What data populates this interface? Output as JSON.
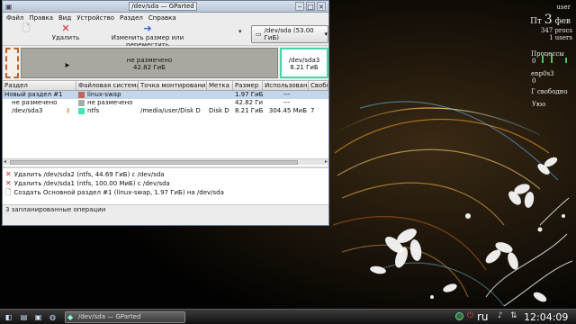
{
  "window": {
    "title": "/dev/sda — GParted"
  },
  "menu": {
    "items": [
      "Файл",
      "Правка",
      "Вид",
      "Устройство",
      "Раздел",
      "Справка"
    ]
  },
  "toolbar": {
    "delete_label": "Удалить",
    "resize_label": "Изменить размер или переместить",
    "device_label": "/dev/sda  (53.00 ГиБ)"
  },
  "diskmap": {
    "unallocated_label": "не размечено",
    "unallocated_size": "42.82 ГиБ",
    "sda3_label": "/dev/sda3",
    "sda3_size": "8.21 ГиБ"
  },
  "table": {
    "headers": [
      "Раздел",
      "Файловая система",
      "Точка монтирования",
      "Метка",
      "Размер",
      "Использовано",
      "Свобод"
    ],
    "rows": [
      {
        "partition": "Новый раздел #1",
        "fs": "linux-swap",
        "fs_color": "#c1665a",
        "mount": "",
        "label": "",
        "size": "1.97 ГиБ",
        "used": "---",
        "free": ""
      },
      {
        "partition": "не размечено",
        "fs": "не размечено",
        "fs_color": "#a9a9a9",
        "mount": "",
        "label": "",
        "size": "42.82 ГиБ",
        "used": "---",
        "free": ""
      },
      {
        "partition": "/dev/sda3",
        "fs": "ntfs",
        "fs_color": "#42e5ac",
        "mount": "/media/user/Disk D",
        "label": "Disk D",
        "size": "8.21 ГиБ",
        "used": "304.45 МиБ",
        "free": "7"
      }
    ]
  },
  "operations": {
    "items": [
      {
        "icon": "delete",
        "text": "Удалить /dev/sda2 (ntfs, 44.69 ГиБ) с /dev/sda"
      },
      {
        "icon": "delete",
        "text": "Удалить /dev/sda1 (ntfs, 100.00 МиБ) с /dev/sda"
      },
      {
        "icon": "create",
        "text": "Создать Основной раздел #1 (linux-swap, 1.97 ГиБ) на /dev/sda"
      }
    ],
    "status": "3 запланированные операции"
  },
  "conky": {
    "user": "user",
    "date_prefix": "Пт",
    "date_day": "3",
    "date_month": "фев",
    "procs": "347 procs",
    "users": "1 users",
    "processes_label": "Процессы",
    "row_0": "0",
    "enp_label": "enp0s3",
    "enp_value": "0",
    "free_label": "Г свободно",
    "disk_label": "Уюо"
  },
  "taskbar": {
    "task_title": "/dev/sda — GParted",
    "lang": "ru",
    "time": "12:04:09"
  }
}
